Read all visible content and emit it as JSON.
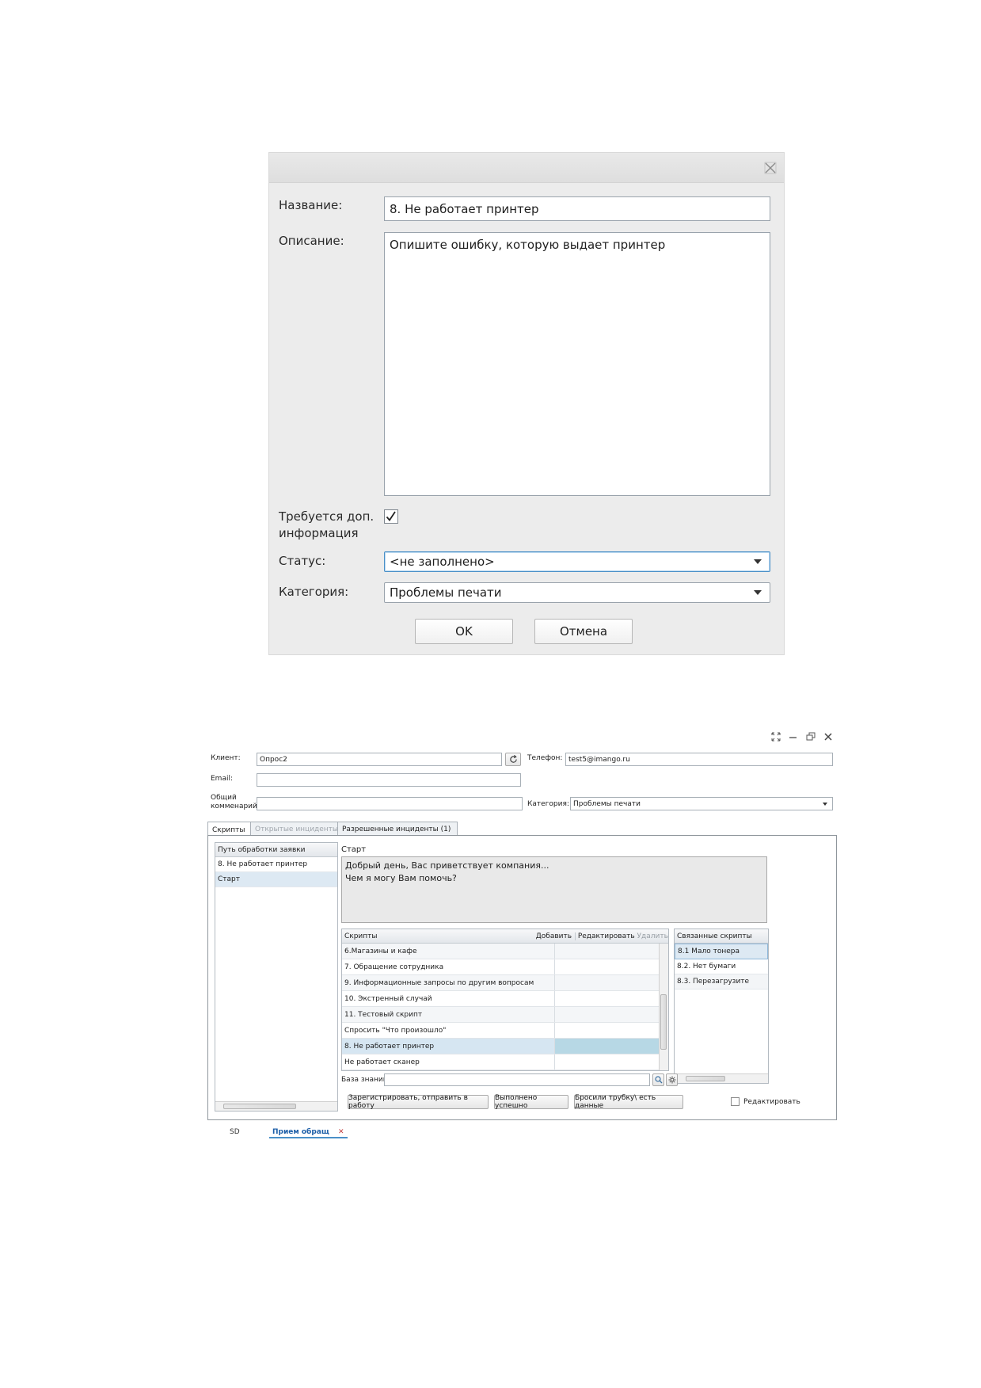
{
  "dialog": {
    "name_label": "Название:",
    "name_value": "8. Не работает принтер",
    "description_label": "Описание:",
    "description_value": "Опишите ошибку, которую выдает принтер",
    "extra_info_label_line1": "Требуется доп.",
    "extra_info_label_line2": "информация",
    "extra_info_checked": true,
    "status_label": "Статус:",
    "status_value": "<не заполнено>",
    "category_label": "Категория:",
    "category_value": "Проблемы печати",
    "ok_label": "OK",
    "cancel_label": "Отмена"
  },
  "app": {
    "client_label": "Клиент:",
    "client_value": "Опрос2",
    "phone_label": "Телефон:",
    "phone_value": "test5@imango.ru",
    "email_label": "Email:",
    "email_value": "",
    "comment_label_line1": "Общий",
    "comment_label_line2": "комменарий:",
    "comment_value": "",
    "category_label": "Категория:",
    "category_value": "Проблемы печати",
    "tabs": [
      {
        "label": "Скрипты"
      },
      {
        "label": "Открытые инциденты"
      },
      {
        "label": "Разрешенные инциденты (1)"
      }
    ],
    "path_header": "Путь обработки заявки",
    "path_items": [
      "8. Не работает принтер",
      "Старт"
    ],
    "start_title": "Старт",
    "start_line1": "Добрый день, Вас приветствует компания...",
    "start_line2": "Чем я могу Вам помочь?",
    "scripts_header": "Скрипты",
    "add_label": "Добавить",
    "edit_label": "Редактировать",
    "delete_label": "Удалить",
    "scripts": [
      "6.Магазины и кафе",
      "7. Обращение сотрудника",
      "9. Информационные запросы по другим вопросам",
      "10. Экстренный случай",
      "11. Тестовый скрипт",
      "Спросить \"Что произошло\"",
      "8. Не работает принтер",
      "Не работает сканер"
    ],
    "linked_header": "Связанные скрипты",
    "linked_scripts": [
      "8.1 Мало тонера",
      "8.2. Нет бумаги",
      "8.3. Перезагрузите"
    ],
    "kb_label": "База знаний",
    "kb_value": "",
    "register_label": "Зарегистрировать, отправить в работу",
    "done_label": "Выполнено успешно",
    "hangup_label": "Бросили трубку\\ есть данные",
    "edit_checkbox_label": "Редактировать",
    "bottom_tabs": {
      "sd": "SD",
      "active": "Прием обращ",
      "close": "✕"
    }
  },
  "colors": {
    "accent": "#4a90c8",
    "selected_row": "#b7d8e5",
    "dialog_bg": "#ececec"
  },
  "icons": [
    "close-icon",
    "check-icon",
    "dropdown-arrow-icon",
    "refresh-icon",
    "search-icon",
    "settings-icon",
    "minimize-icon",
    "restore-icon",
    "maximize-icon"
  ]
}
